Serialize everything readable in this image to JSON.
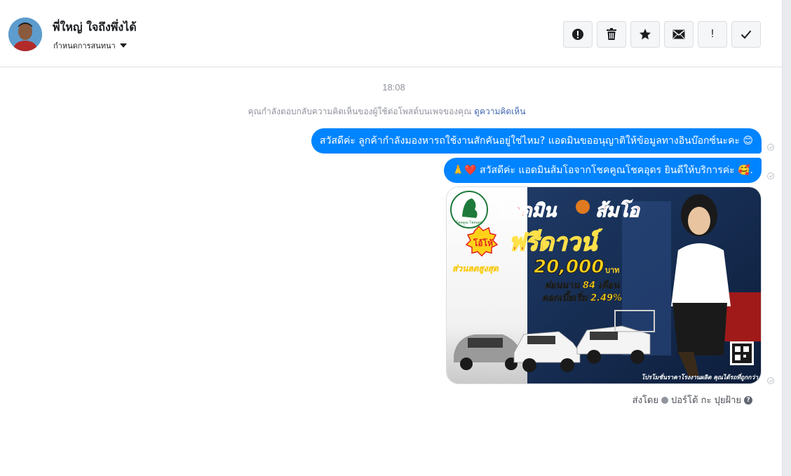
{
  "header": {
    "contact_name": "พี่ใหญ่ ใจถึงพึ่งได้",
    "label_dropdown": "กำหนดการสนทนา",
    "actions": [
      {
        "icon": "exclamation-circle-icon"
      },
      {
        "icon": "trash-icon"
      },
      {
        "icon": "star-icon"
      },
      {
        "icon": "envelope-icon"
      },
      {
        "icon": "exclamation-icon",
        "text": "!"
      },
      {
        "icon": "check-icon"
      }
    ]
  },
  "thread": {
    "timestamp": "18:08",
    "context_text": "คุณกำลังตอบกลับความคิดเห็นของผู้ใช้ต่อโพสต์บนเพจของคุณ",
    "context_link": "ดูความคิดเห็น",
    "messages": [
      {
        "text": "สวัสดีค่ะ ลูกค้ากำลังมองหารถใช้งานสักคันอยู่ใช่ไหม? แอดมินขออนุญาติให้ข้อมูลทางอินบ๊อกซ์นะคะ 😊"
      },
      {
        "text": "🙏❤️ สวัสดีค่ะ แอดมินส้มโอจากโชคคูณโชคอุดร ยินดีให้บริการค่ะ  🥰."
      }
    ],
    "image": {
      "title_left": "แอดมิน",
      "title_right": "ส้มโอ",
      "badge": "โอ้โห้",
      "headline": "ฟรีดาวน์",
      "discount_label": "ส่วนลดสูงสุด",
      "discount_value": "20,000",
      "discount_unit": "บาท",
      "installment": "ผ่อนนาน 84 เดือน",
      "interest": "ดอกเบี้ยเริ่ม 2.49%",
      "footer": "โปรโมชั่นราคาโรงงานผลิต คุณได้รถที่ถูกกว่า"
    },
    "sent_by_label": "ส่งโดย",
    "sent_by_name": "ปอร์โต้ กะ ปุยฝ้าย"
  },
  "colors": {
    "bubble": "#0084ff",
    "link": "#4267b2",
    "muted": "#90949c"
  }
}
